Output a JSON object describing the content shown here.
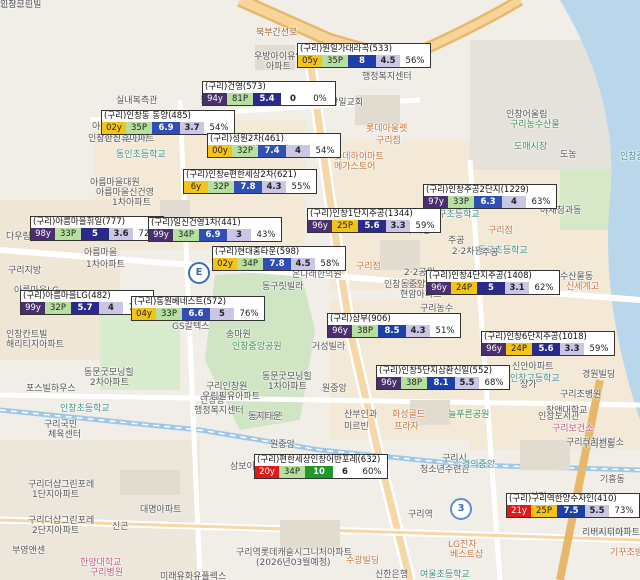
{
  "map": {
    "labels": [
      {
        "text": "북부간선로",
        "cls": "road"
      },
      {
        "text": "우방아이유쉘",
        "cls": ""
      },
      {
        "text": "아파트",
        "cls": ""
      },
      {
        "text": "행정복지센터",
        "cls": ""
      },
      {
        "text": "실내복측관",
        "cls": ""
      },
      {
        "text": "동구중",
        "cls": "teal"
      },
      {
        "text": "창일교회",
        "cls": ""
      },
      {
        "text": "인창동 빌딩사",
        "cls": ""
      },
      {
        "text": "아름마을",
        "cls": ""
      },
      {
        "text": "인창한신휴아파트",
        "cls": ""
      },
      {
        "text": "롯데아울렛",
        "cls": "orange"
      },
      {
        "text": "구리점",
        "cls": "orange"
      },
      {
        "text": "동인초등학교",
        "cls": "teal"
      },
      {
        "text": "롯데하이마트",
        "cls": "orange"
      },
      {
        "text": "메가스토어",
        "cls": "orange"
      },
      {
        "text": "아름마을대원",
        "cls": ""
      },
      {
        "text": "아름마을신건영",
        "cls": ""
      },
      {
        "text": "1차아파트",
        "cls": ""
      },
      {
        "text": "다우림",
        "cls": ""
      },
      {
        "text": "아름마을",
        "cls": ""
      },
      {
        "text": "1차아파트",
        "cls": ""
      },
      {
        "text": "구리지방",
        "cls": ""
      },
      {
        "text": "아름마을LG",
        "cls": ""
      },
      {
        "text": "동구초등학교",
        "cls": "teal"
      },
      {
        "text": "주공",
        "cls": ""
      },
      {
        "text": "2·2차원",
        "cls": ""
      },
      {
        "text": "인창칸트빌",
        "cls": ""
      },
      {
        "text": "해리티지아파트",
        "cls": ""
      },
      {
        "text": "동문굿모닝힐",
        "cls": ""
      },
      {
        "text": "2차아파트",
        "cls": ""
      },
      {
        "text": "포스빌하우스",
        "cls": ""
      },
      {
        "text": "인창초등학교",
        "cls": "teal"
      },
      {
        "text": "구리국민",
        "cls": ""
      },
      {
        "text": "체육센터",
        "cls": ""
      },
      {
        "text": "구리더샵그린포레",
        "cls": ""
      },
      {
        "text": "1단지아파트",
        "cls": ""
      },
      {
        "text": "구리더샵그린포레",
        "cls": ""
      },
      {
        "text": "2단지아파트",
        "cls": ""
      },
      {
        "text": "부영앤센",
        "cls": ""
      },
      {
        "text": "한양대학교",
        "cls": "pink"
      },
      {
        "text": "구리병원",
        "cls": "pink"
      },
      {
        "text": "삼보이",
        "cls": ""
      },
      {
        "text": "대명아파트",
        "cls": ""
      },
      {
        "text": "신곤",
        "cls": ""
      },
      {
        "text": "미래유화유플렉스",
        "cls": ""
      },
      {
        "text": "구리역롯데캐슬시그니처아파트",
        "cls": ""
      },
      {
        "text": "(2026년03월예정)",
        "cls": ""
      },
      {
        "text": "인창동",
        "cls": ""
      },
      {
        "text": "행정복지센터",
        "cls": ""
      },
      {
        "text": "동지타운",
        "cls": ""
      },
      {
        "text": "동문굿모닝힐",
        "cls": ""
      },
      {
        "text": "1차아파트",
        "cls": ""
      },
      {
        "text": "원중앙",
        "cls": ""
      },
      {
        "text": "구리인창원",
        "cls": ""
      },
      {
        "text": "우림필유아파트",
        "cls": ""
      },
      {
        "text": "동지타운",
        "cls": ""
      },
      {
        "text": "GS칼텍스",
        "cls": ""
      },
      {
        "text": "송마원",
        "cls": ""
      },
      {
        "text": "인창중앙공원",
        "cls": "green"
      },
      {
        "text": "동구릿빌라",
        "cls": ""
      },
      {
        "text": "온나래한의원",
        "cls": ""
      },
      {
        "text": "거성빌라",
        "cls": ""
      },
      {
        "text": "원중앙",
        "cls": ""
      },
      {
        "text": "산부인과",
        "cls": ""
      },
      {
        "text": "미르빈",
        "cls": ""
      },
      {
        "text": "화성골드",
        "cls": "orange"
      },
      {
        "text": "프라자",
        "cls": "orange"
      },
      {
        "text": "구리시",
        "cls": ""
      },
      {
        "text": "청소년수련관",
        "cls": ""
      },
      {
        "text": "경의중앙",
        "cls": "teal"
      },
      {
        "text": "구리역",
        "cls": ""
      },
      {
        "text": "LG전자",
        "cls": "orange"
      },
      {
        "text": "베스트샵",
        "cls": "orange"
      },
      {
        "text": "수광빌딩",
        "cls": "orange"
      },
      {
        "text": "신한은행",
        "cls": ""
      },
      {
        "text": "여울초등학교",
        "cls": "teal"
      },
      {
        "text": "구리우체국",
        "cls": ""
      },
      {
        "text": "현대아파트",
        "cls": ""
      },
      {
        "text": "리버시티아파트",
        "cls": ""
      },
      {
        "text": "구리조병원",
        "cls": ""
      },
      {
        "text": "구리보건소",
        "cls": "pink"
      },
      {
        "text": "구리전철변전소",
        "cls": ""
      },
      {
        "text": "인창도서관",
        "cls": ""
      },
      {
        "text": "늘푸른공원",
        "cls": "green"
      },
      {
        "text": "인창고등학교",
        "cls": "teal"
      },
      {
        "text": "상가",
        "cls": ""
      },
      {
        "text": "신안아파트",
        "cls": ""
      },
      {
        "text": "인창어울림",
        "cls": ""
      },
      {
        "text": "구리농수산물",
        "cls": "green"
      },
      {
        "text": "도매시장",
        "cls": "green"
      },
      {
        "text": "야채청과동",
        "cls": ""
      },
      {
        "text": "수산물동",
        "cls": ""
      },
      {
        "text": "신세계고",
        "cls": "orange"
      },
      {
        "text": "구리점",
        "cls": "orange"
      },
      {
        "text": "구리광교",
        "cls": ""
      },
      {
        "text": "동구초등학교",
        "cls": "teal"
      },
      {
        "text": "주공",
        "cls": ""
      },
      {
        "text": "2·2공원",
        "cls": ""
      },
      {
        "text": "홈플러스",
        "cls": "orange"
      },
      {
        "text": "구리점",
        "cls": "orange"
      },
      {
        "text": "인창동중앙교회",
        "cls": ""
      },
      {
        "text": "구리농수",
        "cls": ""
      },
      {
        "text": "인창중학교",
        "cls": "teal"
      },
      {
        "text": "도농",
        "cls": ""
      },
      {
        "text": "기흥동",
        "cls": ""
      },
      {
        "text": "구리전통",
        "cls": ""
      },
      {
        "text": "장앤대학교",
        "cls": ""
      },
      {
        "text": "경원빌딩",
        "cls": ""
      },
      {
        "text": "사기",
        "cls": ""
      },
      {
        "text": "인창아파트",
        "cls": ""
      },
      {
        "text": "현대교",
        "cls": ""
      },
      {
        "text": "기꾸조방 본점",
        "cls": "orange"
      },
      {
        "text": "현암아파트",
        "cls": ""
      },
      {
        "text": "사천",
        "cls": ""
      },
      {
        "text": "교문문도",
        "cls": ""
      },
      {
        "text": "인창그린빌",
        "cls": ""
      }
    ],
    "pin_number": "3",
    "pin_letter": "E"
  },
  "cards": [
    {
      "title": "(구리)원일가대라곡(533)",
      "age": "05y",
      "floor": "35P",
      "a": "8",
      "b": "4.5",
      "pct": "56%",
      "age_bg": "#f3c318",
      "floor_bg": "#b7e0a0",
      "a_bg": "#1d3fa8",
      "b_bg": "#c9c6e6"
    },
    {
      "title": "(구리)건영(573)",
      "age": "94y",
      "floor": "81P",
      "a": "5.4",
      "b": "0",
      "pct": "0%",
      "age_bg": "#4a2f6e",
      "floor_bg": "#b7e0a0",
      "a_bg": "#2a2a8a",
      "b_bg": "#ffffff"
    },
    {
      "title": "(구리)인창동 동양(485)",
      "age": "02y",
      "floor": "35P",
      "a": "6.9",
      "b": "3.7",
      "pct": "54%",
      "age_bg": "#f3c318",
      "floor_bg": "#b7e0a0",
      "a_bg": "#2f4fb5",
      "b_bg": "#c9c6e6"
    },
    {
      "title": "(구리)성원2차(461)",
      "age": "00y",
      "floor": "32P",
      "a": "7.4",
      "b": "4",
      "pct": "54%",
      "age_bg": "#f3c318",
      "floor_bg": "#b7e0a0",
      "a_bg": "#2f4fb5",
      "b_bg": "#c9c6e6"
    },
    {
      "title": "(구리)인창e편한세상2차(621)",
      "age": "6y",
      "floor": "32P",
      "a": "7.8",
      "b": "4.3",
      "pct": "55%",
      "age_bg": "#f3c318",
      "floor_bg": "#b7e0a0",
      "a_bg": "#2f4fb5",
      "b_bg": "#c9c6e6"
    },
    {
      "title": "(구리)인창주공2단지(1229)",
      "age": "97y",
      "floor": "33P",
      "a": "6.3",
      "b": "4",
      "pct": "63%",
      "age_bg": "#4a2f6e",
      "floor_bg": "#b7e0a0",
      "a_bg": "#2f4fb5",
      "b_bg": "#c9c6e6"
    },
    {
      "title": "(구리)아름마을휘일(777)",
      "age": "98y",
      "floor": "33P",
      "a": "5",
      "b": "3.6",
      "pct": "72%",
      "age_bg": "#4a2f6e",
      "floor_bg": "#b7e0a0",
      "a_bg": "#2a2a8a",
      "b_bg": "#c9c6e6"
    },
    {
      "title": "(구리)일신건영1차(441)",
      "age": "99y",
      "floor": "34P",
      "a": "6.9",
      "b": "3",
      "pct": "43%",
      "age_bg": "#4a2f6e",
      "floor_bg": "#b7e0a0",
      "a_bg": "#2f4fb5",
      "b_bg": "#c9c6e6"
    },
    {
      "title": "(구리)인창1단지주공(1344)",
      "age": "96y",
      "floor": "25P",
      "a": "5.6",
      "b": "3.3",
      "pct": "59%",
      "age_bg": "#4a2f6e",
      "floor_bg": "#f3c318",
      "a_bg": "#2a2a8a",
      "b_bg": "#c9c6e6"
    },
    {
      "title": "(구리)현대홈타운(598)",
      "age": "02y",
      "floor": "34P",
      "a": "7.8",
      "b": "4.5",
      "pct": "58%",
      "age_bg": "#f3c318",
      "floor_bg": "#b7e0a0",
      "a_bg": "#2f4fb5",
      "b_bg": "#c9c6e6"
    },
    {
      "title": "(구리)인창4단지주공(1408)",
      "age": "96y",
      "floor": "24P",
      "a": "5",
      "b": "3.1",
      "pct": "62%",
      "age_bg": "#4a2f6e",
      "floor_bg": "#f3c318",
      "a_bg": "#2a2a8a",
      "b_bg": "#c9c6e6"
    },
    {
      "title": "(구리)아름마을LG(482)",
      "age": "99y",
      "floor": "32P",
      "a": "5.7",
      "b": "4",
      "pct": "70%",
      "age_bg": "#4a2f6e",
      "floor_bg": "#b7e0a0",
      "a_bg": "#2a2a8a",
      "b_bg": "#c9c6e6"
    },
    {
      "title": "(구리)동원베네스트(572)",
      "age": "04y",
      "floor": "33P",
      "a": "6.6",
      "b": "5",
      "pct": "76%",
      "age_bg": "#f3c318",
      "floor_bg": "#b7e0a0",
      "a_bg": "#2f4fb5",
      "b_bg": "#c9c6e6"
    },
    {
      "title": "(구리)삼부(906)",
      "age": "96y",
      "floor": "38P",
      "a": "8.5",
      "b": "4.3",
      "pct": "51%",
      "age_bg": "#4a2f6e",
      "floor_bg": "#b7e0a0",
      "a_bg": "#1d3fa8",
      "b_bg": "#c9c6e6"
    },
    {
      "title": "(구리)인창6단지주공(1018)",
      "age": "96y",
      "floor": "24P",
      "a": "5.6",
      "b": "3.3",
      "pct": "59%",
      "age_bg": "#4a2f6e",
      "floor_bg": "#f3c318",
      "a_bg": "#2a2a8a",
      "b_bg": "#c9c6e6"
    },
    {
      "title": "(구리)인창5단지삼환신일(552)",
      "age": "96y",
      "floor": "38P",
      "a": "8.1",
      "b": "5.5",
      "pct": "68%",
      "age_bg": "#4a2f6e",
      "floor_bg": "#b7e0a0",
      "a_bg": "#1d3fa8",
      "b_bg": "#c9c6e6"
    },
    {
      "title": "(구리)편한세상인창어반포레(632)",
      "age": "20y",
      "floor": "34P",
      "a": "10",
      "b": "6",
      "pct": "60%",
      "age_bg": "#e01a1a",
      "floor_bg": "#b7e0a0",
      "a_bg": "#1d9a2a",
      "b_bg": "#ffffff"
    },
    {
      "title": "(구리)구리역한양수자인(410)",
      "age": "21y",
      "floor": "25P",
      "a": "7.5",
      "b": "5.5",
      "pct": "73%",
      "age_bg": "#e01a1a",
      "floor_bg": "#f3c318",
      "a_bg": "#1d3fa8",
      "b_bg": "#c9c6e6"
    }
  ]
}
